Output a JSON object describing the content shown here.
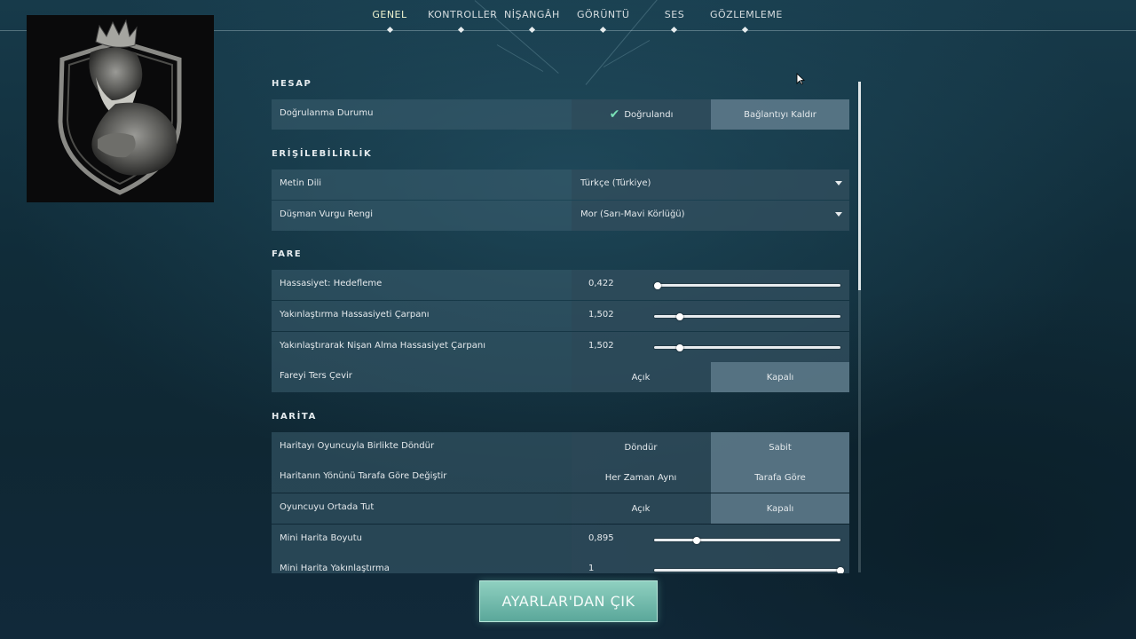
{
  "nav": {
    "tabs": [
      {
        "label": "GENEL",
        "active": true
      },
      {
        "label": "KONTROLLER",
        "active": false
      },
      {
        "label": "NİŞANGÂH",
        "active": false
      },
      {
        "label": "GÖRÜNTÜ",
        "active": false
      },
      {
        "label": "SES",
        "active": false
      },
      {
        "label": "GÖZLEMLEME",
        "active": false
      }
    ]
  },
  "player_card": {
    "icon": "crowned-warrior-shield-icon"
  },
  "sections": {
    "hesap": {
      "title": "HESAP",
      "verification": {
        "label": "Doğrulanma Durumu",
        "status": "Doğrulandı",
        "action": "Bağlantıyı Kaldır"
      }
    },
    "erisilebilirlik": {
      "title": "ERİŞİLEBİLİRLİK",
      "text_language": {
        "label": "Metin Dili",
        "value": "Türkçe (Türkiye)"
      },
      "enemy_highlight": {
        "label": "Düşman Vurgu Rengi",
        "value": "Mor (Sarı-Mavi Körlüğü)"
      }
    },
    "fare": {
      "title": "FARE",
      "sensitivity": {
        "label": "Hassasiyet: Hedefleme",
        "value": "0,422",
        "level": 0.02
      },
      "zoom_multiplier": {
        "label": "Yakınlaştırma Hassasiyeti Çarpanı",
        "value": "1,502",
        "level": 0.14
      },
      "ads_multiplier": {
        "label": "Yakınlaştırarak Nişan Alma Hassasiyet Çarpanı",
        "value": "1,502",
        "level": 0.14
      },
      "invert_mouse": {
        "label": "Fareyi Ters Çevir",
        "option_on": "Açık",
        "option_off": "Kapalı",
        "selected": "Kapalı"
      }
    },
    "harita": {
      "title": "HARİTA",
      "rotate": {
        "label": "Haritayı Oyuncuyla Birlikte Döndür",
        "option_a": "Döndür",
        "option_b": "Sabit",
        "selected": "Sabit"
      },
      "orientation": {
        "label": "Haritanın Yönünü Tarafa Göre Değiştir",
        "option_a": "Her Zaman Aynı",
        "option_b": "Tarafa Göre",
        "selected": "Tarafa Göre"
      },
      "center_player": {
        "label": "Oyuncuyu Ortada Tut",
        "option_a": "Açık",
        "option_b": "Kapalı",
        "selected": "Kapalı"
      },
      "minimap_size": {
        "label": "Mini Harita Boyutu",
        "value": "0,895",
        "level": 0.23
      },
      "minimap_zoom": {
        "label": "Mini Harita Yakınlaştırma",
        "value": "1",
        "level": 1.0
      }
    }
  },
  "exit_button": {
    "label": "AYARLAR'DAN ÇIK"
  },
  "colors": {
    "accent": "#79e0b6",
    "button": "#6fb8a9",
    "active_tab": "#eef3cf"
  }
}
